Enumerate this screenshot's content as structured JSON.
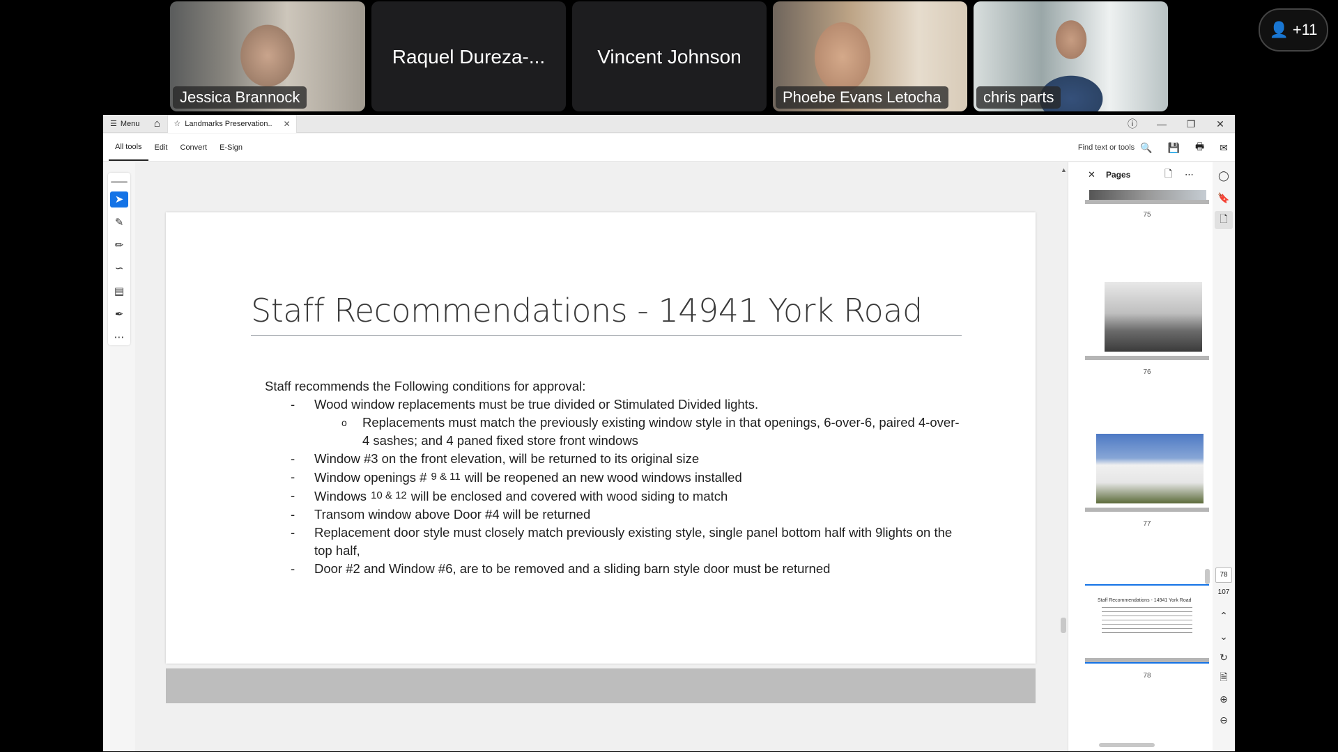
{
  "participants": [
    {
      "name": "Jessica Brannock",
      "video": true,
      "palette": [
        "#6b6a66",
        "#b59a85",
        "#e9e4dc"
      ]
    },
    {
      "name": "Raquel Dureza-...",
      "video": false
    },
    {
      "name": "Vincent Johnson",
      "video": false
    },
    {
      "name": "Phoebe Evans Letocha",
      "video": true,
      "palette": [
        "#caa986",
        "#3a3330",
        "#e6dccd"
      ]
    },
    {
      "name": "chris parts",
      "video": true,
      "palette": [
        "#bfc7c9",
        "#334a6a",
        "#e7ecec"
      ]
    }
  ],
  "more_participants": "+11",
  "app": {
    "menu_label": "Menu",
    "tab_title": "Landmarks Preservation..",
    "toolbar_tabs": [
      "All tools",
      "Edit",
      "Convert",
      "E-Sign"
    ],
    "find_placeholder": "Find text or tools"
  },
  "slide": {
    "title": "Staff Recommendations - 14941 York Road",
    "intro": "Staff recommends the Following conditions for approval:",
    "b1": "Wood window replacements must be true divided or Stimulated Divided lights.",
    "b1_sub": "Replacements must match the previously existing window style in that openings, 6-over-6, paired 4-over-4 sashes; and 4 paned fixed store front windows",
    "b2": "Window #3 on the front elevation, will be returned to its original size",
    "b3_pre": "Window openings #",
    "b3_sup": "9 & 11",
    "b3_post": "will be reopened an new wood windows installed",
    "b4_pre": "Windows",
    "b4_sup": "10 & 12",
    "b4_post": "will be enclosed and covered with wood siding to match",
    "b5": "Transom window above Door #4 will be returned",
    "b6": "Replacement door style must closely match previously existing style, single panel bottom half with 9lights on the top half,",
    "b7": "Door #2 and Window #6, are to be removed and a sliding barn style door must be returned"
  },
  "pages_panel": {
    "title": "Pages",
    "thumbs": [
      {
        "label": "75"
      },
      {
        "label": "76"
      },
      {
        "label": "77"
      },
      {
        "label": "78",
        "caption": "Staff Recommendations - 14941 York Road"
      }
    ]
  },
  "page_nav": {
    "current": "78",
    "total": "107"
  }
}
